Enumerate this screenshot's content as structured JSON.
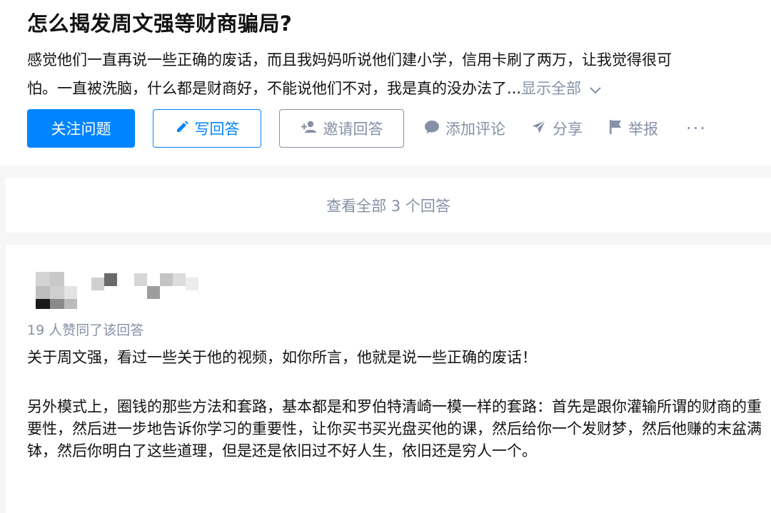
{
  "question": {
    "title": "怎么揭发周文强等财商骗局?",
    "detail_line1": "感觉他们一直再说一些正确的废话，而且我妈妈听说他们建小学，信用卡刷了两万，让我觉得很可",
    "detail_line2": "怕。一直被洗脑，什么都是财商好，不能说他们不对，我是真的没办法了...",
    "show_all": "显示全部"
  },
  "actions": {
    "follow": "关注问题",
    "write": "写回答",
    "invite": "邀请回答",
    "comment": "添加评论",
    "share": "分享",
    "report": "举报",
    "more": "···"
  },
  "view_all": "查看全部 3 个回答",
  "answer": {
    "votes": "19 人赞同了该回答",
    "para1": "关于周文强，看过一些关于他的视频，如你所言，他就是说一些正确的废话！",
    "para2": "另外模式上，圈钱的那些方法和套路，基本都是和罗伯特清崎一模一样的套路：首先是跟你灌输所谓的财商的重要性，然后进一步地告诉你学习的重要性，让你买书买光盘买他的课，然后给你一个发财梦，然后他赚的末盆满钵，然后你明白了这些道理，但是还是依旧过不好人生，依旧还是穷人一个。"
  },
  "colors": {
    "primary": "#0084ff",
    "muted": "#8590a6",
    "text": "#121212",
    "page_bg": "#f6f6f6"
  },
  "icons": [
    "pencil-icon",
    "add-user-icon",
    "comment-icon",
    "share-icon",
    "flag-icon",
    "chevron-down-icon",
    "more-icon"
  ]
}
